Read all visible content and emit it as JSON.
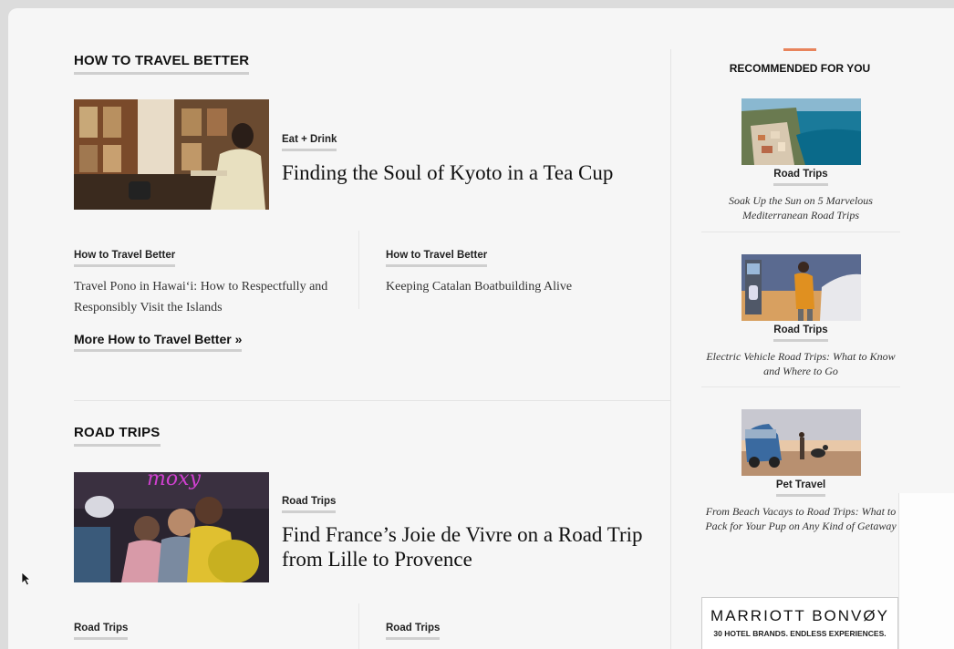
{
  "sections": {
    "travel_better": {
      "title": "HOW TO TRAVEL BETTER",
      "feature": {
        "tag": "Eat + Drink",
        "headline": "Finding the Soul of Kyoto in a Tea Cup"
      },
      "cards": [
        {
          "tag": "How to Travel Better",
          "title": "Travel Pono in Hawai‘i: How to Respectfully and Responsibly Visit the Islands"
        },
        {
          "tag": "How to Travel Better",
          "title": "Keeping Catalan Boatbuilding Alive"
        }
      ],
      "more_link": "More How to Travel Better »"
    },
    "road_trips": {
      "title": "ROAD TRIPS",
      "feature": {
        "tag": "Road Trips",
        "headline": "Find France’s Joie de Vivre on a Road Trip from Lille to Provence",
        "image_text": "moxy"
      },
      "cards": [
        {
          "tag": "Road Trips"
        },
        {
          "tag": "Road Trips"
        }
      ]
    }
  },
  "recommended": {
    "title": "RECOMMENDED FOR YOU",
    "items": [
      {
        "tag": "Road Trips",
        "title": "Soak Up the Sun on 5 Marvelous Mediterranean Road Trips"
      },
      {
        "tag": "Road Trips",
        "title": "Electric Vehicle Road Trips: What to Know and Where to Go"
      },
      {
        "tag": "Pet Travel",
        "title": "From Beach Vacays to Road Trips: What to Pack for Your Pup on Any Kind of Getaway"
      }
    ]
  },
  "ad": {
    "brand": "MARRIOTT BONVØY",
    "tagline": "30 HOTEL BRANDS. ENDLESS EXPERIENCES."
  },
  "colors": {
    "accent": "#e8845c",
    "underline": "#cfcfcf",
    "divider": "#e4e4e4"
  }
}
